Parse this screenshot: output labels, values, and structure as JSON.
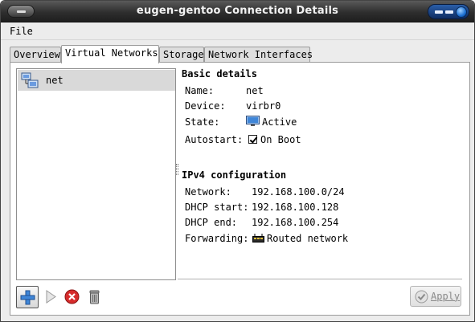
{
  "window": {
    "title": "eugen-gentoo Connection Details"
  },
  "menubar": {
    "file": "File"
  },
  "tabs": [
    {
      "label": "Overview"
    },
    {
      "label": "Virtual Networks"
    },
    {
      "label": "Storage"
    },
    {
      "label": "Network Interfaces"
    }
  ],
  "networks": [
    {
      "name": "net",
      "icon": "network-icon"
    }
  ],
  "basic_details": {
    "heading": "Basic details",
    "name_label": "Name:",
    "name_value": "net",
    "device_label": "Device:",
    "device_value": "virbr0",
    "state_label": "State:",
    "state_value": "Active",
    "autostart_label": "Autostart:",
    "autostart_value": "On Boot"
  },
  "ipv4": {
    "heading": "IPv4 configuration",
    "network_label": "Network:",
    "network_value": "192.168.100.0/24",
    "dhcp_start_label": "DHCP start:",
    "dhcp_start_value": "192.168.100.128",
    "dhcp_end_label": "DHCP end:",
    "dhcp_end_value": "192.168.100.254",
    "forwarding_label": "Forwarding:",
    "forwarding_value": "Routed network"
  },
  "toolbar": {
    "apply_label": "Apply"
  },
  "colors": {
    "titlebar": "#2e2e2e",
    "selection": "#d9d9d9",
    "window_controls": "#1b6fd1",
    "delete": "#d62c2c"
  }
}
